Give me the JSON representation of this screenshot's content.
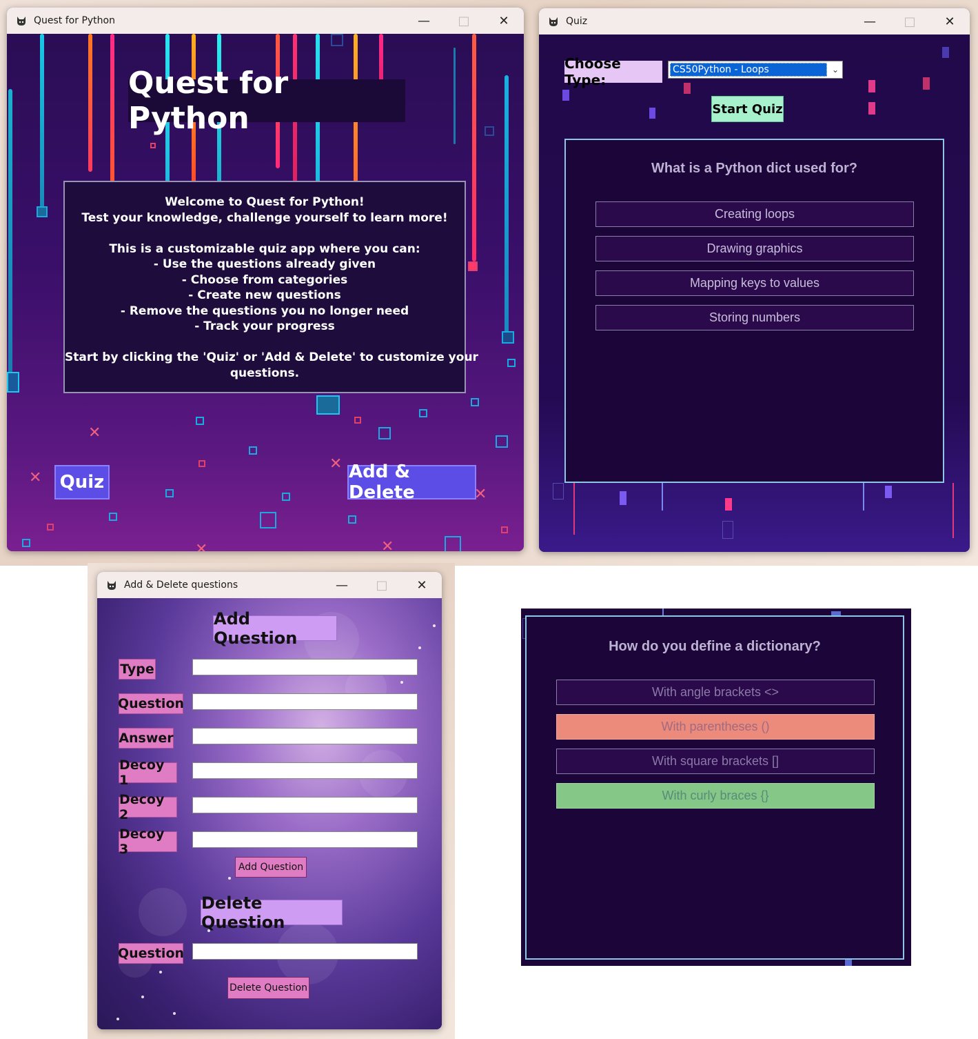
{
  "background_colors": {
    "quiz_panel": "#1c0538",
    "wrong_answer": "#ec8a7c",
    "correct_answer": "#84c787",
    "quiz_button": "#5b4de6",
    "start_button": "#a7f2cd",
    "section_title": "#cf9cf4",
    "field_label": "#e07cc4"
  },
  "main_window": {
    "title": "Quest for Python",
    "app_icon": "cat-icon",
    "hero_title": "Quest for Python",
    "welcome_lines": [
      "Welcome to Quest for Python!",
      "Test your knowledge, challenge yourself to learn more!",
      "",
      "This is a customizable quiz app where you can:",
      "- Use the questions already given",
      "- Choose from categories",
      "- Create new questions",
      "- Remove the questions you no longer need",
      "- Track your progress",
      "",
      "Start by clicking the 'Quiz' or 'Add & Delete' to customize your",
      "questions."
    ],
    "quiz_button": "Quiz",
    "add_delete_button": "Add & Delete"
  },
  "quiz_window": {
    "title": "Quiz",
    "app_icon": "cat-icon",
    "choose_type_label": "Choose Type:",
    "selected_type": "CS50Python - Loops",
    "start_button": "Start Quiz",
    "question": "What is a Python dict used for?",
    "options": [
      "Creating loops",
      "Drawing graphics",
      "Mapping keys to values",
      "Storing numbers"
    ]
  },
  "add_delete_window": {
    "title": "Add & Delete questions",
    "app_icon": "cat-icon",
    "add_title": "Add Question",
    "fields": [
      {
        "label": "Type",
        "value": ""
      },
      {
        "label": "Question",
        "value": ""
      },
      {
        "label": "Answer",
        "value": ""
      },
      {
        "label": "Decoy 1",
        "value": ""
      },
      {
        "label": "Decoy 2",
        "value": ""
      },
      {
        "label": "Decoy 3",
        "value": ""
      }
    ],
    "add_button": "Add Question",
    "delete_title": "Delete Question",
    "delete_field_label": "Question",
    "delete_field_value": "",
    "delete_button": "Delete Question"
  },
  "answer_panel": {
    "question": "How do you define a dictionary?",
    "options": [
      {
        "label": "With angle brackets <>",
        "state": "neutral"
      },
      {
        "label": "With parentheses ()",
        "state": "wrong"
      },
      {
        "label": "With square brackets []",
        "state": "neutral"
      },
      {
        "label": "With curly braces {}",
        "state": "correct"
      }
    ]
  }
}
